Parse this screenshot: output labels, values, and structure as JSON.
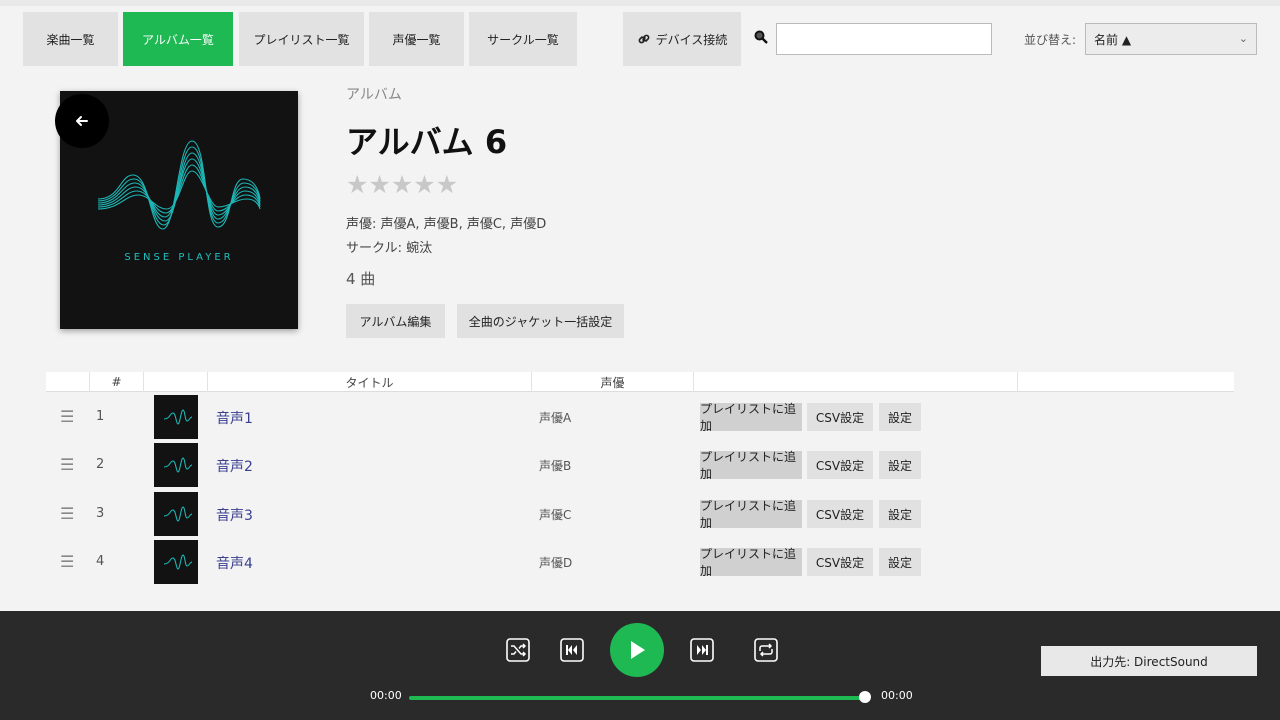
{
  "nav": {
    "tabs": [
      {
        "label": "楽曲一覧"
      },
      {
        "label": "アルバム一覧"
      },
      {
        "label": "プレイリスト一覧"
      },
      {
        "label": "声優一覧"
      },
      {
        "label": "サークル一覧"
      }
    ],
    "device_label": "デバイス接続",
    "search": {
      "value": "",
      "placeholder": ""
    },
    "sort_label": "並び替え:",
    "sort_value": "名前 ▲"
  },
  "album": {
    "kind": "アルバム",
    "title": "アルバム 6",
    "rating": 0,
    "stars": "★★★★★",
    "voice_actors": "声優: 声優A, 声優B, 声優C, 声優D",
    "circle": "サークル: 蜿汰",
    "track_count": "4 曲",
    "cover_text": "SENSE PLAYER",
    "edit_label": "アルバム編集",
    "bulk_jacket_label": "全曲のジャケット一括設定"
  },
  "table": {
    "headers": {
      "num": "#",
      "title": "タイトル",
      "actor": "声優"
    },
    "rows": [
      {
        "num": "1",
        "title": "音声1",
        "actor": "声優A",
        "add_label": "プレイリストに追加",
        "csv_label": "CSV設定",
        "settings_label": "設定"
      },
      {
        "num": "2",
        "title": "音声2",
        "actor": "声優B",
        "add_label": "プレイリストに追加",
        "csv_label": "CSV設定",
        "settings_label": "設定"
      },
      {
        "num": "3",
        "title": "音声3",
        "actor": "声優C",
        "add_label": "プレイリストに追加",
        "csv_label": "CSV設定",
        "settings_label": "設定"
      },
      {
        "num": "4",
        "title": "音声4",
        "actor": "声優D",
        "add_label": "プレイリストに追加",
        "csv_label": "CSV設定",
        "settings_label": "設定"
      }
    ]
  },
  "player": {
    "current_time": "00:00",
    "total_time": "00:00",
    "progress_fraction": 1.0,
    "output_label": "出力先: DirectSound"
  },
  "colors": {
    "accent": "#1fb954",
    "player_bg": "#2a2a2a",
    "cover_teal": "#1fbfbf"
  }
}
